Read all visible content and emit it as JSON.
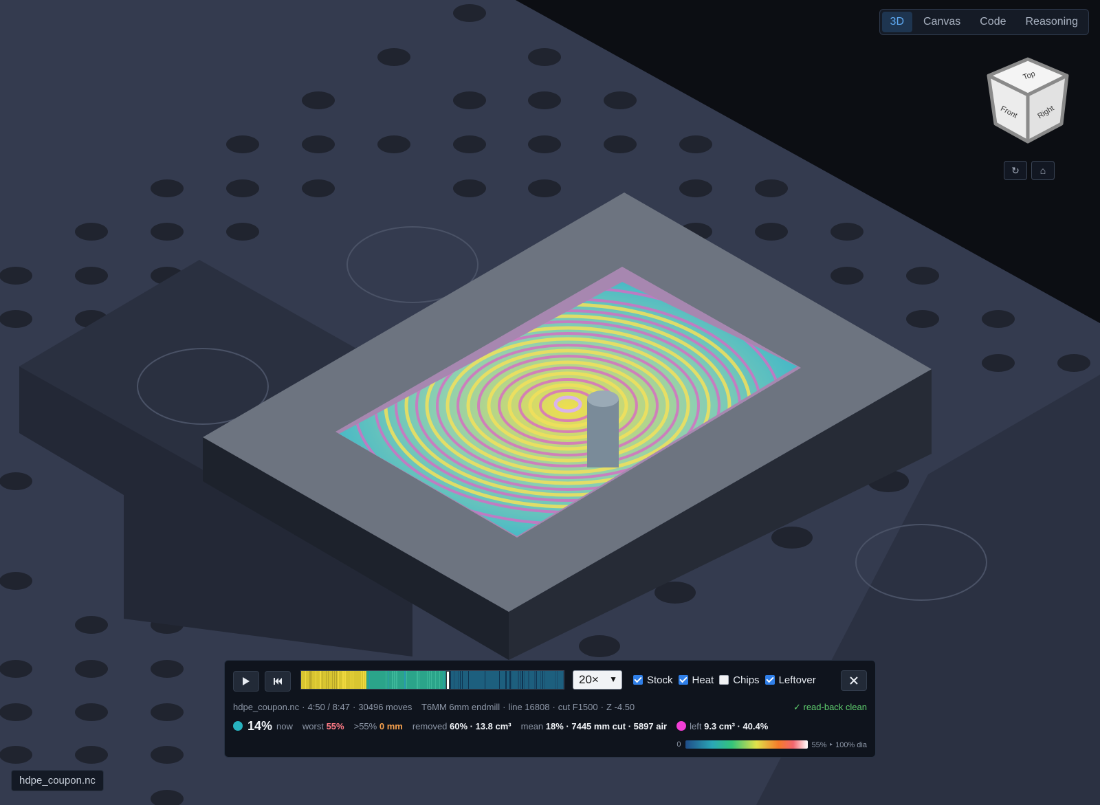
{
  "tabs": [
    {
      "label": "3D",
      "active": true
    },
    {
      "label": "Canvas",
      "active": false
    },
    {
      "label": "Code",
      "active": false
    },
    {
      "label": "Reasoning",
      "active": false
    }
  ],
  "view_cube": {
    "top": "Top",
    "front": "Front",
    "right": "Right"
  },
  "player": {
    "speed": "20×",
    "progress": 0.556,
    "toggles": {
      "stock": {
        "label": "Stock",
        "checked": true
      },
      "heat": {
        "label": "Heat",
        "checked": true
      },
      "chips": {
        "label": "Chips",
        "checked": false
      },
      "leftover": {
        "label": "Leftover",
        "checked": true
      }
    },
    "info": {
      "file": "hdpe_coupon.nc",
      "time": "4:50 / 8:47",
      "moves": "30496 moves",
      "tool": "T6MM 6mm endmill",
      "line": "line 16808",
      "feed": "cut F1500",
      "z": "Z -4.50",
      "readback": "✓ read-back clean"
    },
    "stats": {
      "now_value": "14%",
      "now_label": "now",
      "worst_label": "worst",
      "worst_value": "55%",
      "over_label": ">55%",
      "over_value": "0 mm",
      "removed_label": "removed",
      "removed_value": "60% · 13.8 cm³",
      "mean_label": "mean",
      "mean_value": "18% · 7445 mm cut · 5897 air",
      "left_label": "left",
      "left_value": "9.3 cm³ · 40.4%"
    },
    "legend": {
      "min": "0",
      "max": "55% ‣ 100% dia"
    },
    "colors": {
      "now_dot": "#27b2bf",
      "left_dot": "#f23fd6",
      "accent": "#2f7fe8"
    }
  },
  "file_chip": "hdpe_coupon.nc"
}
